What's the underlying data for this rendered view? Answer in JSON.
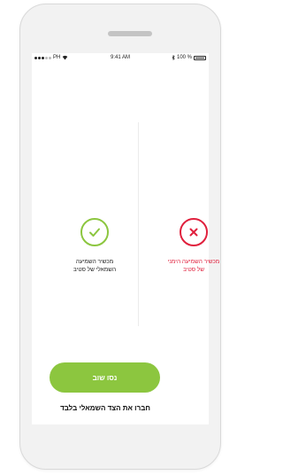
{
  "status_bar": {
    "carrier": "PH",
    "time": "9:41 AM",
    "battery": "100 %"
  },
  "devices": {
    "left": {
      "label_line1": "מכשיר השמיעה",
      "label_line2": "השמאלי של סטיב",
      "state": "connected",
      "icon": "check-icon",
      "color": "#8cc63f"
    },
    "right": {
      "label_line1": "מכשיר השמיעה הימני",
      "label_line2": "של סטיב",
      "state": "failed",
      "icon": "close-icon",
      "color": "#e0203d"
    }
  },
  "actions": {
    "retry_label": "נסו שוב",
    "hint": "חברו את הצד השמאלי בלבד"
  }
}
